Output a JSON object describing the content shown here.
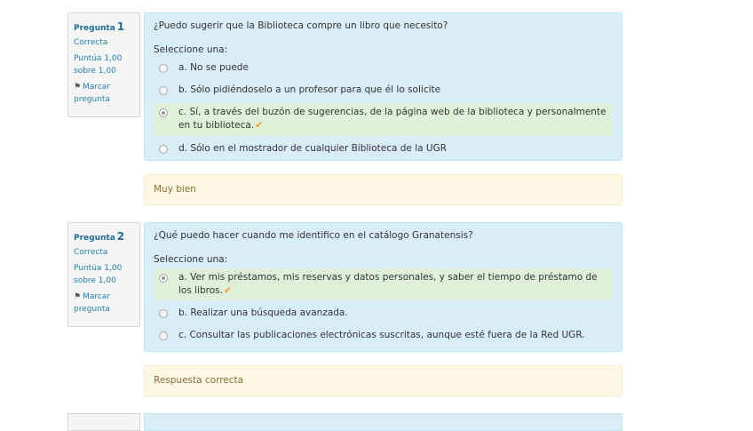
{
  "questions": [
    {
      "label": "Pregunta",
      "number": "1",
      "state": "Correcta",
      "grade": "Puntúa 1,00 sobre 1,00",
      "flag": "Marcar pregunta",
      "text": "¿Puedo sugerir que la Biblioteca compre un libro que necesito?",
      "prompt": "Seleccione una:",
      "options": [
        "a. No se puede",
        "b. Sólo pidiéndoselo a un profesor para que él lo solicite",
        "c. Sí, a través del buzón de sugerencias, de la página web de la biblioteca y personalmente en tu biblioteca.",
        "d. Sólo en el mostrador de cualquier Biblioteca de la UGR"
      ],
      "feedback": "Muy bien"
    },
    {
      "label": "Pregunta",
      "number": "2",
      "state": "Correcta",
      "grade": "Puntúa 1,00 sobre 1,00",
      "flag": "Marcar pregunta",
      "text": "¿Qué puedo hacer cuando me identifico en el catálogo Granatensis?",
      "prompt": "Seleccione una:",
      "options": [
        "a. Ver mis préstamos, mis reservas y datos personales, y saber el tiempo de préstamo de los libros.",
        "b. Realizar una búsqueda avanzada.",
        "c. Consultar las publicaciones electrónicas suscritas, aunque esté fuera de la Red UGR."
      ],
      "feedback": "Respuesta correcta"
    }
  ],
  "icons": {
    "flag": "flag-icon",
    "tick": "check-icon"
  },
  "colors": {
    "question_bg": "#d9edf7",
    "correct_bg": "#dff0d8",
    "feedback_bg": "#fcf8e3",
    "tick": "#f0a020"
  }
}
